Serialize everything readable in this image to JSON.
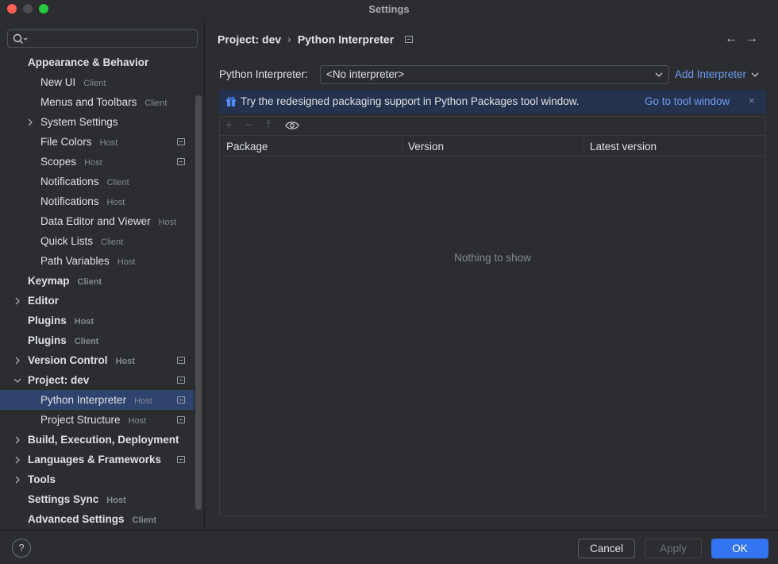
{
  "window": {
    "title": "Settings"
  },
  "search": {
    "placeholder": ""
  },
  "sidebar": {
    "items": [
      {
        "label": "Appearance & Behavior",
        "tag": "",
        "level": 1,
        "bold": true,
        "chevron": "",
        "icon": false,
        "selected": false
      },
      {
        "label": "New UI",
        "tag": "Client",
        "level": 2,
        "bold": false,
        "chevron": "",
        "icon": false,
        "selected": false
      },
      {
        "label": "Menus and Toolbars",
        "tag": "Client",
        "level": 2,
        "bold": false,
        "chevron": "",
        "icon": false,
        "selected": false
      },
      {
        "label": "System Settings",
        "tag": "",
        "level": 2,
        "bold": false,
        "chevron": "right",
        "icon": false,
        "selected": false
      },
      {
        "label": "File Colors",
        "tag": "Host",
        "level": 2,
        "bold": false,
        "chevron": "",
        "icon": true,
        "selected": false
      },
      {
        "label": "Scopes",
        "tag": "Host",
        "level": 2,
        "bold": false,
        "chevron": "",
        "icon": true,
        "selected": false
      },
      {
        "label": "Notifications",
        "tag": "Client",
        "level": 2,
        "bold": false,
        "chevron": "",
        "icon": false,
        "selected": false
      },
      {
        "label": "Notifications",
        "tag": "Host",
        "level": 2,
        "bold": false,
        "chevron": "",
        "icon": false,
        "selected": false
      },
      {
        "label": "Data Editor and Viewer",
        "tag": "Host",
        "level": 2,
        "bold": false,
        "chevron": "",
        "icon": false,
        "selected": false
      },
      {
        "label": "Quick Lists",
        "tag": "Client",
        "level": 2,
        "bold": false,
        "chevron": "",
        "icon": false,
        "selected": false
      },
      {
        "label": "Path Variables",
        "tag": "Host",
        "level": 2,
        "bold": false,
        "chevron": "",
        "icon": false,
        "selected": false
      },
      {
        "label": "Keymap",
        "tag": "Client",
        "level": 1,
        "bold": true,
        "chevron": "",
        "icon": false,
        "selected": false
      },
      {
        "label": "Editor",
        "tag": "",
        "level": 1,
        "bold": true,
        "chevron": "right",
        "icon": false,
        "selected": false
      },
      {
        "label": "Plugins",
        "tag": "Host",
        "level": 1,
        "bold": true,
        "chevron": "",
        "icon": false,
        "selected": false
      },
      {
        "label": "Plugins",
        "tag": "Client",
        "level": 1,
        "bold": true,
        "chevron": "",
        "icon": false,
        "selected": false
      },
      {
        "label": "Version Control",
        "tag": "Host",
        "level": 1,
        "bold": true,
        "chevron": "right",
        "icon": true,
        "selected": false
      },
      {
        "label": "Project: dev",
        "tag": "",
        "level": 1,
        "bold": true,
        "chevron": "down",
        "icon": true,
        "selected": false
      },
      {
        "label": "Python Interpreter",
        "tag": "Host",
        "level": 2,
        "bold": false,
        "chevron": "",
        "icon": true,
        "selected": true
      },
      {
        "label": "Project Structure",
        "tag": "Host",
        "level": 2,
        "bold": false,
        "chevron": "",
        "icon": true,
        "selected": false
      },
      {
        "label": "Build, Execution, Deployment",
        "tag": "",
        "level": 1,
        "bold": true,
        "chevron": "right",
        "icon": false,
        "selected": false
      },
      {
        "label": "Languages & Frameworks",
        "tag": "",
        "level": 1,
        "bold": true,
        "chevron": "right",
        "icon": true,
        "selected": false
      },
      {
        "label": "Tools",
        "tag": "",
        "level": 1,
        "bold": true,
        "chevron": "right",
        "icon": false,
        "selected": false
      },
      {
        "label": "Settings Sync",
        "tag": "Host",
        "level": 1,
        "bold": true,
        "chevron": "",
        "icon": false,
        "selected": false
      },
      {
        "label": "Advanced Settings",
        "tag": "Client",
        "level": 1,
        "bold": true,
        "chevron": "",
        "icon": false,
        "selected": false
      }
    ]
  },
  "breadcrumb": {
    "parent": "Project: dev",
    "separator": "›",
    "current": "Python Interpreter"
  },
  "nav": {
    "back": "←",
    "forward": "→"
  },
  "interpreter": {
    "label": "Python Interpreter:",
    "value": "<No interpreter>",
    "add_label": "Add Interpreter"
  },
  "banner": {
    "message": "Try the redesigned packaging support in Python Packages tool window.",
    "link": "Go to tool window",
    "close": "×"
  },
  "packages": {
    "toolbar": {
      "add": "+",
      "remove": "−",
      "upgrade": "⤒"
    },
    "columns": [
      "Package",
      "Version",
      "Latest version"
    ],
    "rows": [],
    "empty_text": "Nothing to show"
  },
  "footer": {
    "help": "?",
    "cancel": "Cancel",
    "apply": "Apply",
    "ok": "OK"
  },
  "colors": {
    "accent": "#3574f0",
    "link": "#6f9cf5",
    "selection": "#2e436e",
    "banner": "#25324d"
  }
}
